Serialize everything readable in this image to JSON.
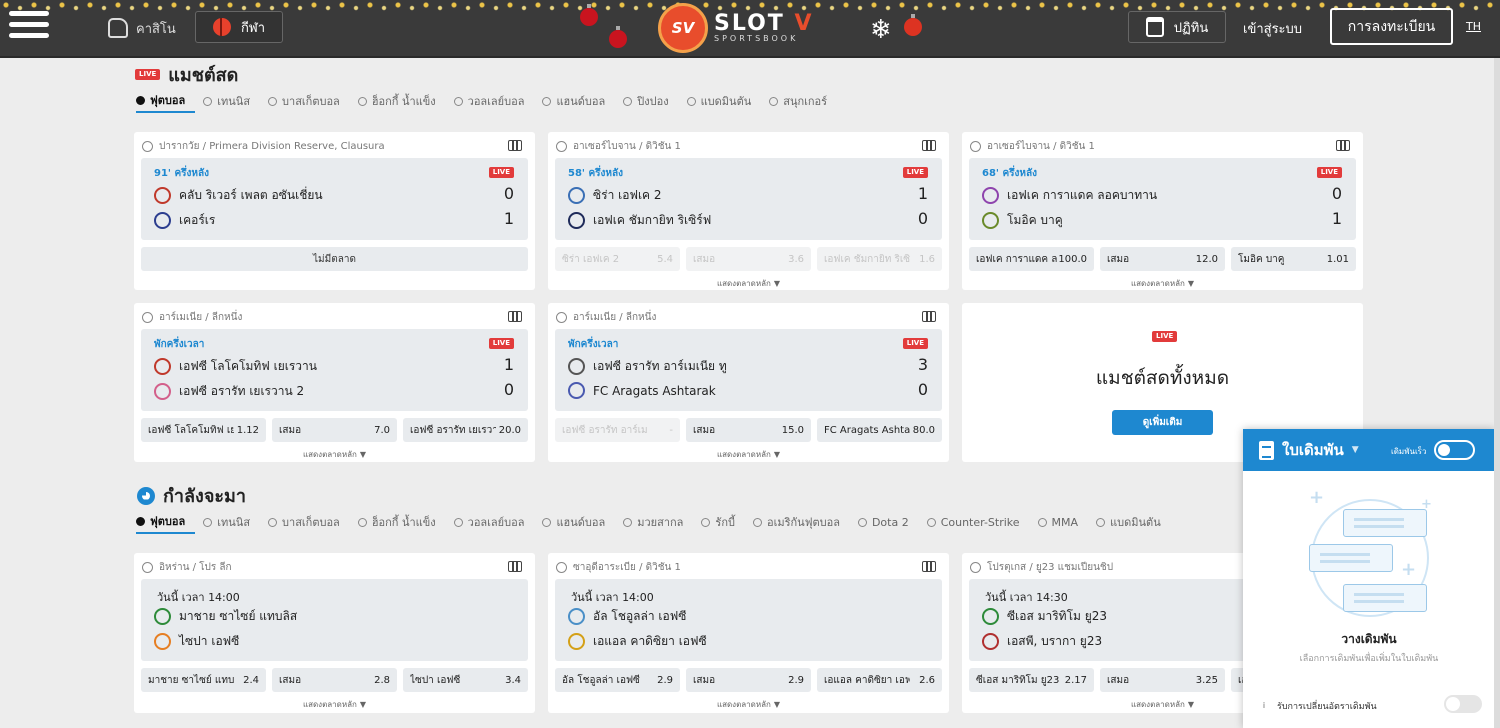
{
  "header": {
    "casino_label": "คาสิโน",
    "sports_label": "กีฬา",
    "logo_text": "SLOT V",
    "logo_sub": "SPORTSBOOK",
    "logo_badge": "SV",
    "calendar_label": "ปฏิทิน",
    "login_label": "เข้าสู่ระบบ",
    "register_label": "การลงทะเบียน",
    "lang_label": "TH"
  },
  "live_section": {
    "badge": "LIVE",
    "title": "แมชต์สด",
    "tabs": [
      "ฟุตบอล",
      "เทนนิส",
      "บาสเก็ตบอล",
      "ฮ็อกกี้ น้ำแข็ง",
      "วอลเลย์บอล",
      "แฮนด์บอล",
      "ปิงปอง",
      "แบดมินตัน",
      "สนุกเกอร์"
    ],
    "cards": [
      {
        "league": "ปารากวัย / Primera Division Reserve, Clausura",
        "time": "91' ครึ่งหลัง",
        "badge": "LIVE",
        "team1": "คลับ ริเวอร์ เพลต อซันเชี่ยน",
        "score1": "0",
        "team2": "เคอร์เร",
        "score2": "1",
        "no_market": "ไม่มีตลาด"
      },
      {
        "league": "อาเซอร์ไบจาน / ดิวิชัน 1",
        "time": "58' ครึ่งหลัง",
        "badge": "LIVE",
        "team1": "ซิร่า เอฟเค 2",
        "score1": "1",
        "team2": "เอฟเค ชัมกายิท ริเซิร์ฟ",
        "score2": "0",
        "odds": [
          {
            "name": "ซิร่า เอฟเค 2",
            "value": "5.4"
          },
          {
            "name": "เสมอ",
            "value": "3.6"
          },
          {
            "name": "เอฟเค ชัมกายิท ริเซิร์ฟ",
            "value": "1.6"
          }
        ],
        "more": "แสดงตลาดหลัก"
      },
      {
        "league": "อาเซอร์ไบจาน / ดิวิชัน 1",
        "time": "68' ครึ่งหลัง",
        "badge": "LIVE",
        "team1": "เอฟเค การาแดค ลอคบาทาน",
        "score1": "0",
        "team2": "โมอิค บาคู",
        "score2": "1",
        "odds": [
          {
            "name": "เอฟเค การาแดค ลอ",
            "value": "100.0"
          },
          {
            "name": "เสมอ",
            "value": "12.0"
          },
          {
            "name": "โมอิค บาคู",
            "value": "1.01"
          }
        ],
        "more": "แสดงตลาดหลัก"
      },
      {
        "league": "อาร์เมเนีย / ลีกหนึ่ง",
        "time": "พักครึ่งเวลา",
        "badge": "LIVE",
        "team1": "เอฟซี โลโคโมทิฟ เยเรวาน",
        "score1": "1",
        "team2": "เอฟซี อรารัท เยเรวาน 2",
        "score2": "0",
        "odds": [
          {
            "name": "เอฟซี โลโคโมทิฟ เยเร",
            "value": "1.12"
          },
          {
            "name": "เสมอ",
            "value": "7.0"
          },
          {
            "name": "เอฟซี อรารัท เยเรวา",
            "value": "20.0"
          }
        ],
        "more": "แสดงตลาดหลัก"
      },
      {
        "league": "อาร์เมเนีย / ลีกหนึ่ง",
        "time": "พักครึ่งเวลา",
        "badge": "LIVE",
        "team1": "เอฟซี อรารัท อาร์เมเนีย ทู",
        "score1": "3",
        "team2": "FC Aragats Ashtarak",
        "score2": "0",
        "odds": [
          {
            "name": "เอฟซี อรารัท อาร์เมเนีย",
            "value": "-"
          },
          {
            "name": "เสมอ",
            "value": "15.0"
          },
          {
            "name": "FC Aragats Ashtar",
            "value": "80.0"
          }
        ],
        "more": "แสดงตลาดหลัก"
      }
    ],
    "all_live": {
      "badge": "LIVE",
      "title": "แมชต์สดทั้งหมด",
      "button": "ดูเพิ่มเติม"
    }
  },
  "upcoming_section": {
    "title": "กำลังจะมา",
    "tabs": [
      "ฟุตบอล",
      "เทนนิส",
      "บาสเก็ตบอล",
      "ฮ็อกกี้ น้ำแข็ง",
      "วอลเลย์บอล",
      "แฮนด์บอล",
      "มวยสากล",
      "รักบี้",
      "อเมริกันฟุตบอล",
      "Dota 2",
      "Counter-Strike",
      "MMA",
      "แบดมินตัน"
    ],
    "cards": [
      {
        "league": "อิหร่าน / โปร ลีก",
        "time": "วันนี้ เวลา 14:00",
        "team1": "มาชาย ซาไซย์ แทบลิส",
        "team2": "ไซปา เอฟซี",
        "odds": [
          {
            "name": "มาชาย ซาไซย์ แทบลิส",
            "value": "2.4"
          },
          {
            "name": "เสมอ",
            "value": "2.8"
          },
          {
            "name": "ไซปา เอฟซี",
            "value": "3.4"
          }
        ],
        "more": "แสดงตลาดหลัก"
      },
      {
        "league": "ซาอุดีอาระเบีย / ดิวิชัน 1",
        "time": "วันนี้ เวลา 14:00",
        "team1": "อัล โชอูลล่า เอฟซี",
        "team2": "เอแอล คาดิซิยา เอฟซี",
        "odds": [
          {
            "name": "อัล โชอูลล่า เอฟซี",
            "value": "2.9"
          },
          {
            "name": "เสมอ",
            "value": "2.9"
          },
          {
            "name": "เอแอล คาดิซิยา เอฟซี",
            "value": "2.6"
          }
        ],
        "more": "แสดงตลาดหลัก"
      },
      {
        "league": "โปรตุเกส / ยู23 แชมเปียนชิป",
        "time": "วันนี้ เวลา 14:30",
        "team1": "ซีเอส มาริทิโม ยู23",
        "team2": "เอสพี, บรากา ยู23",
        "odds": [
          {
            "name": "ซีเอส มาริทิโม ยู23",
            "value": "2.17"
          },
          {
            "name": "เสมอ",
            "value": "3.25"
          },
          {
            "name": "เอ",
            "value": ""
          }
        ],
        "more": "แสดงตลาดหลัก"
      }
    ]
  },
  "betslip": {
    "title": "ใบเดิมพัน",
    "quick_label": "เดิมพันเร็ว",
    "empty_title": "วางเดิมพัน",
    "empty_sub": "เลือกการเดิมพันเพื่อเพิ่มในใบเดิมพัน",
    "accept_label": "รับการเปลี่ยนอัตราเดิมพัน"
  },
  "colors": {
    "accent": "#1e88d0",
    "live": "#e23b3b",
    "header": "#3a3a3a"
  }
}
